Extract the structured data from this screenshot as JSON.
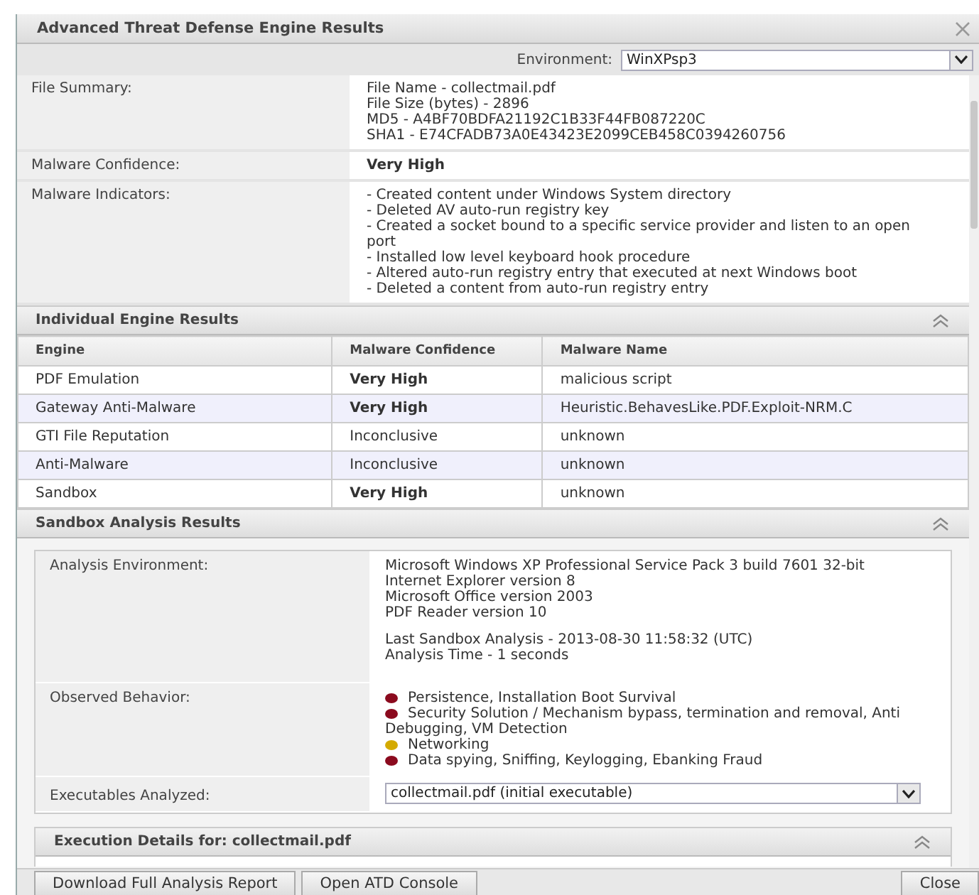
{
  "window": {
    "title": "Advanced Threat Defense Engine Results"
  },
  "environment": {
    "label": "Environment:",
    "value": "WinXPsp3"
  },
  "summary": [
    {
      "label": "File Summary:",
      "lines": [
        "File Name - collectmail.pdf",
        "File Size (bytes) - 2896",
        "MD5 - A4BF70BDFA21192C1B33F44FB087220C",
        "SHA1 - E74CFADB73A0E43423E2099CEB458C0394260756"
      ],
      "bold": false
    },
    {
      "label": "Malware Confidence:",
      "lines": [
        "Very High"
      ],
      "bold": true
    },
    {
      "label": "Malware Indicators:",
      "lines": [
        "- Created content under Windows System directory",
        "- Deleted AV auto-run registry key",
        "- Created a socket bound to a specific service provider and listen to an open port",
        "- Installed low level keyboard hook procedure",
        "- Altered auto-run registry entry that executed at next Windows boot",
        "- Deleted a content from auto-run registry entry"
      ],
      "bold": false
    }
  ],
  "engine_results": {
    "title": "Individual Engine Results",
    "expanded": true,
    "columns": [
      "Engine",
      "Malware Confidence",
      "Malware Name"
    ],
    "rows": [
      {
        "engine": "PDF Emulation",
        "confidence": "Very High",
        "high": true,
        "name": "malicious script"
      },
      {
        "engine": "Gateway Anti-Malware",
        "confidence": "Very High",
        "high": true,
        "name": "Heuristic.BehavesLike.PDF.Exploit-NRM.C"
      },
      {
        "engine": "GTI File Reputation",
        "confidence": "Inconclusive",
        "high": false,
        "name": "unknown"
      },
      {
        "engine": "Anti-Malware",
        "confidence": "Inconclusive",
        "high": false,
        "name": "unknown"
      },
      {
        "engine": "Sandbox",
        "confidence": "Very High",
        "high": true,
        "name": "unknown"
      }
    ]
  },
  "sandbox": {
    "title": "Sandbox Analysis Results",
    "expanded": true,
    "environment_label": "Analysis Environment:",
    "environment_lines": [
      "Microsoft Windows XP Professional Service Pack 3 build 7601 32-bit",
      "Internet Explorer version 8",
      "Microsoft Office version 2003",
      "PDF Reader version 10"
    ],
    "analysis_lines": [
      "Last Sandbox Analysis - 2013-08-30 11:58:32 (UTC)",
      "Analysis Time - 1 seconds"
    ],
    "behavior_label": "Observed Behavior:",
    "behaviors": [
      {
        "text": "Persistence, Installation Boot Survival",
        "color": "#8b0a1e"
      },
      {
        "text": "Security Solution / Mechanism bypass, termination and removal, Anti Debugging, VM Detection",
        "color": "#8b0a1e"
      },
      {
        "text": "Networking",
        "color": "#d4aa00"
      },
      {
        "text": "Data spying, Sniffing, Keylogging, Ebanking Fraud",
        "color": "#8b0a1e"
      }
    ],
    "executables_label": "Executables Analyzed:",
    "executable": "collectmail.pdf (initial executable)"
  },
  "execution": {
    "title": "Execution Details for: collectmail.pdf",
    "expanded": true
  },
  "buttons": [
    "Download Full Analysis Report",
    "Open ATD Console"
  ],
  "close_button": "Close"
}
